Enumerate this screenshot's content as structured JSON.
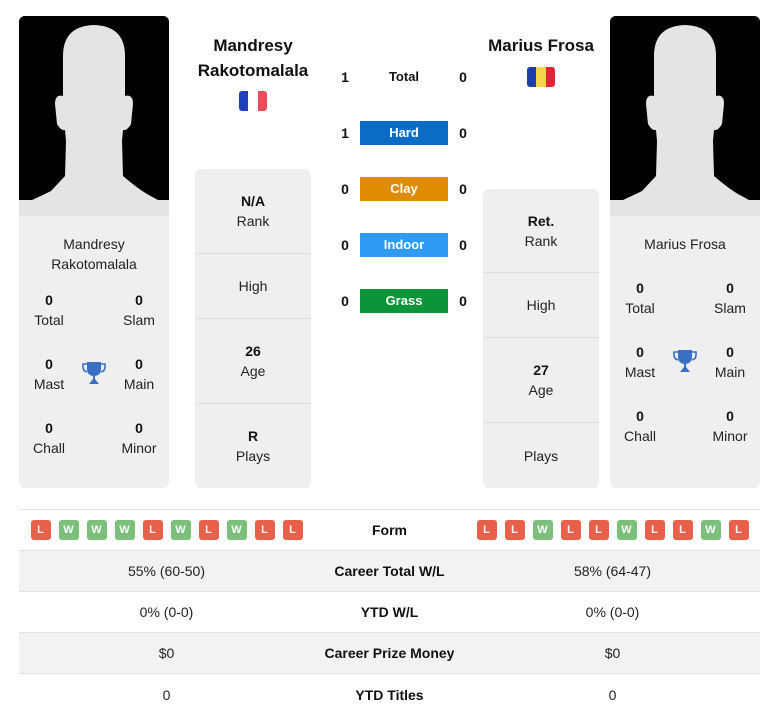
{
  "players": [
    {
      "name": "Mandresy Rakotomalala",
      "name_line1": "Mandresy",
      "name_line2": "Rakotomalala",
      "flag": [
        "#1f3fbf",
        "#ffffff",
        "#ef4a5a"
      ],
      "country": "France",
      "titles": {
        "total": {
          "value": "0",
          "label": "Total"
        },
        "slam": {
          "value": "0",
          "label": "Slam"
        },
        "mast": {
          "value": "0",
          "label": "Mast"
        },
        "main": {
          "value": "0",
          "label": "Main"
        },
        "chall": {
          "value": "0",
          "label": "Chall"
        },
        "minor": {
          "value": "0",
          "label": "Minor"
        }
      },
      "stats": [
        {
          "value": "N/A",
          "label": "Rank"
        },
        {
          "value": "",
          "label": "High"
        },
        {
          "value": "26",
          "label": "Age"
        },
        {
          "value": "R",
          "label": "Plays"
        }
      ],
      "form": [
        "L",
        "W",
        "W",
        "W",
        "L",
        "W",
        "L",
        "W",
        "L",
        "L"
      ],
      "career_wl": "55% (60-50)",
      "ytd_wl": "0% (0-0)",
      "prize_money": "$0",
      "ytd_titles": "0"
    },
    {
      "name": "Marius Frosa",
      "name_line1": "Marius Frosa",
      "flag": [
        "#1f3fa8",
        "#f7d54a",
        "#e2243b"
      ],
      "country": "Romania",
      "titles": {
        "total": {
          "value": "0",
          "label": "Total"
        },
        "slam": {
          "value": "0",
          "label": "Slam"
        },
        "mast": {
          "value": "0",
          "label": "Mast"
        },
        "main": {
          "value": "0",
          "label": "Main"
        },
        "chall": {
          "value": "0",
          "label": "Chall"
        },
        "minor": {
          "value": "0",
          "label": "Minor"
        }
      },
      "stats": [
        {
          "value": "Ret.",
          "label": "Rank"
        },
        {
          "value": "",
          "label": "High"
        },
        {
          "value": "27",
          "label": "Age"
        },
        {
          "value": "",
          "label": "Plays"
        }
      ],
      "form": [
        "L",
        "L",
        "W",
        "L",
        "L",
        "W",
        "L",
        "L",
        "W",
        "L"
      ],
      "career_wl": "58% (64-47)",
      "ytd_wl": "0% (0-0)",
      "prize_money": "$0",
      "ytd_titles": "0"
    }
  ],
  "h2h": [
    {
      "label": "Total",
      "left": "1",
      "right": "0",
      "color": ""
    },
    {
      "label": "Hard",
      "left": "1",
      "right": "0",
      "color": "#0a6cc4"
    },
    {
      "label": "Clay",
      "left": "0",
      "right": "0",
      "color": "#e08c00"
    },
    {
      "label": "Indoor",
      "left": "0",
      "right": "0",
      "color": "#2f9bf5"
    },
    {
      "label": "Grass",
      "left": "0",
      "right": "0",
      "color": "#0b9438"
    }
  ],
  "comparison": {
    "form_label": "Form",
    "career_wl_label": "Career Total W/L",
    "ytd_wl_label": "YTD W/L",
    "prize_label": "Career Prize Money",
    "ytd_titles_label": "YTD Titles"
  },
  "icons": {
    "trophy": "trophy-icon",
    "avatar": "player-silhouette"
  },
  "colors": {
    "win": "#7cbf7a",
    "loss": "#e8604a",
    "trophy": "#3a6fc4",
    "panel": "#efefef"
  }
}
